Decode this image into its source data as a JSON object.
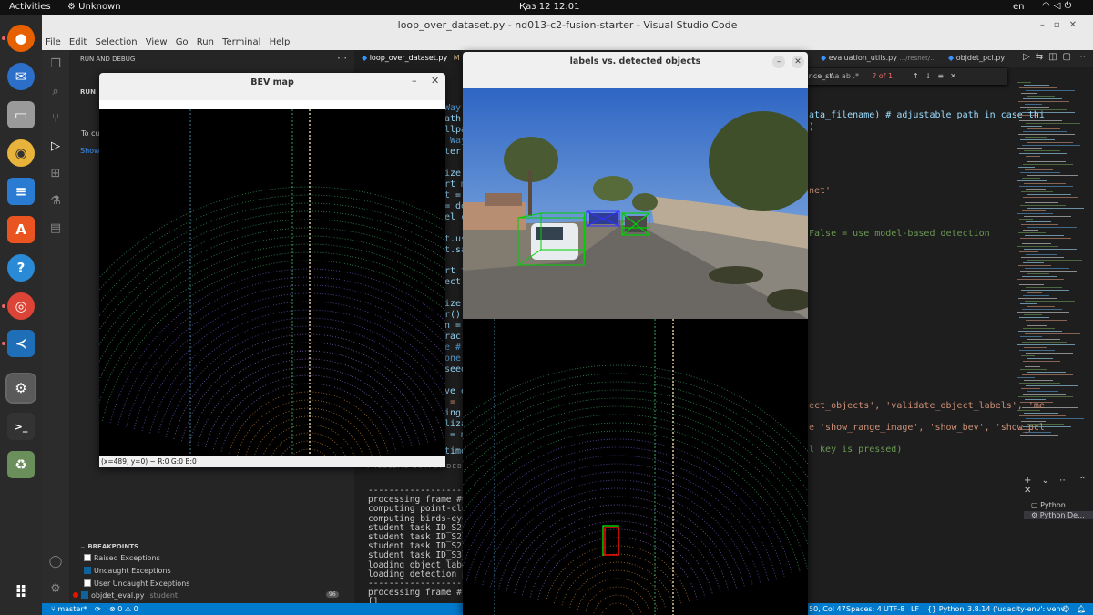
{
  "topbar": {
    "activities": "Activities",
    "app_name": "Unknown",
    "clock": "Қаз 12  12:01",
    "language": "en"
  },
  "dock": {
    "icons": [
      "firefox-icon",
      "thunderbird-icon",
      "files-icon",
      "rhythmbox-icon",
      "writer-icon",
      "app-center-icon",
      "help-icon",
      "chrome-icon",
      "vscode-icon",
      "settings-icon",
      "terminal-icon",
      "trash-icon",
      "show-apps-icon"
    ]
  },
  "vscode": {
    "title": "loop_over_dataset.py - nd013-c2-fusion-starter - Visual Studio Code",
    "menu": [
      "File",
      "Edit",
      "Selection",
      "View",
      "Go",
      "Run",
      "Terminal",
      "Help"
    ],
    "sidebar": {
      "header": "RUN AND DEBUG",
      "run_label": "RUN",
      "to_customize": "To cu",
      "show_link": "Show",
      "breakpoints_header": "BREAKPOINTS",
      "breakpoints": [
        {
          "label": "Raised Exceptions",
          "checked": false
        },
        {
          "label": "Uncaught Exceptions",
          "checked": true
        },
        {
          "label": "User Uncaught Exceptions",
          "checked": false
        }
      ],
      "breakpoint_file": {
        "label": "objdet_eval.py",
        "folder": "student",
        "count": "96"
      }
    },
    "tabs": [
      {
        "label": "loop_over_dataset.py",
        "badge": "M"
      },
      {
        "label": "evaluation_utils.py",
        "path": ".../resnet/..."
      },
      {
        "label": "objdet_pcl.py"
      }
    ],
    "find": {
      "query": "e_performance_st",
      "options": "Aa",
      "result": "? of 1"
    },
    "code_fragments_left": [
      "Way",
      "ath",
      "llpa",
      " Way",
      "ter",
      "ize",
      "rt m",
      "t =",
      "= de",
      "el c",
      "t.us",
      "t.sa",
      "rt t",
      "ect.",
      "ize",
      "r()",
      "n =",
      "rac",
      "e #",
      "one",
      "seed",
      "ve e",
      " = ['",
      "ing",
      "liza",
      " = ma",
      "time"
    ],
    "code_fragments_right": [
      "ata_filename) # adjustable path in case thi",
      ")",
      "net'",
      "False = use model-based detection",
      "ect_objects', 'validate_object_labels', 'me",
      "e 'show_range_image', 'show_bev', 'show_pcl",
      "l key is pressed)"
    ],
    "panel_tabs": "PROBLEMS    OUTPUT    DEB",
    "terminal_lines": [
      "-----------------------------",
      "processing frame #0",
      "computing point-cloud",
      "computing birds-eye v",
      "student task ID_S2_EX",
      "student task ID_S2_EX",
      "student task ID_S2_EX",
      "student task ID_S3_EX",
      "loading object labels",
      "loading detection per",
      "-----------------------------",
      "",
      "processing frame #1",
      "[]"
    ],
    "terminal_list": [
      "Python",
      "Python De..."
    ],
    "status": {
      "branch": "master*",
      "errors": "0",
      "warnings": "0",
      "position": "50, Col 47",
      "spaces": "Spaces: 4",
      "encoding": "UTF-8",
      "eol": "LF",
      "language": "Python",
      "interpreter": "3.8.14 ('udacity-env': venv)"
    }
  },
  "bev_window": {
    "title": "BEV map",
    "status": "(x=489, y=0) ~ R:0 G:0 B:0"
  },
  "labels_window": {
    "title": "labels vs. detected objects"
  },
  "colors": {
    "accent": "#007acc",
    "label_box": "#00ff00",
    "detection_box": "#ff0000"
  }
}
